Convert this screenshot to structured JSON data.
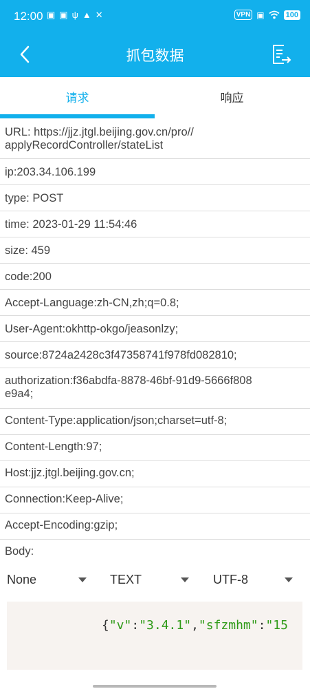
{
  "status_bar": {
    "time": "12:00",
    "vpn": "VPN",
    "battery": "100"
  },
  "app_bar": {
    "title": "抓包数据"
  },
  "tabs": [
    {
      "label": "请求"
    },
    {
      "label": "响应"
    }
  ],
  "request": {
    "url_line1": "URL: https://jjz.jtgl.beijing.gov.cn/pro//",
    "url_line2": "applyRecordController/stateList",
    "ip": "ip:203.34.106.199",
    "type": "type: POST",
    "time": "time: 2023-01-29 11:54:46",
    "size": "size: 459",
    "code": "code:200",
    "accept_language": "Accept-Language:zh-CN,zh;q=0.8;",
    "user_agent": "User-Agent:okhttp-okgo/jeasonlzy;",
    "source": "source:8724a2428c3f47358741f978fd082810;",
    "authorization_line1": "authorization:f36abdfa-8878-46bf-91d9-5666f808",
    "authorization_line2": "e9a4;",
    "content_type": "Content-Type:application/json;charset=utf-8;",
    "content_length": "Content-Length:97;",
    "host": "Host:jjz.jtgl.beijing.gov.cn;",
    "connection": "Connection:Keep-Alive;",
    "accept_encoding": "Accept-Encoding:gzip;"
  },
  "body": {
    "label": "Body:",
    "selects": {
      "format": "None",
      "type": "TEXT",
      "charset": "UTF-8"
    },
    "code": {
      "p1": "{",
      "s1": "\"v\"",
      "p2": ":",
      "s2": "\"3.4.1\"",
      "p3": ",",
      "s3": "\"sfzmhm\"",
      "p4": ":",
      "s4": "\"15"
    }
  }
}
